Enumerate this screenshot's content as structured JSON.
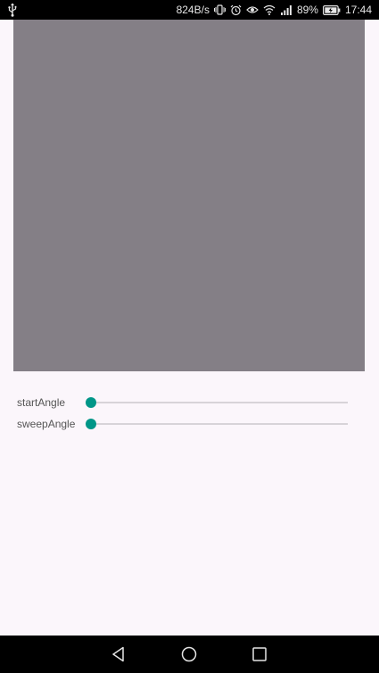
{
  "status_bar": {
    "usb_icon": "usb-icon",
    "network_speed": "824B/s",
    "icons": [
      "vibrate-icon",
      "alarm-icon",
      "eye-icon",
      "wifi-icon",
      "signal-icon"
    ],
    "battery_percent": "89%",
    "battery_icon": "battery-charging-icon",
    "time": "17:44"
  },
  "canvas": {
    "color": "#847f86"
  },
  "controls": {
    "accent_color": "#009688",
    "start_angle": {
      "label": "startAngle",
      "value": 0.0
    },
    "sweep_angle": {
      "label": "sweepAngle",
      "value": 0.0
    }
  },
  "nav_bar": {
    "icons": [
      "back-icon",
      "home-icon",
      "recents-icon"
    ]
  }
}
